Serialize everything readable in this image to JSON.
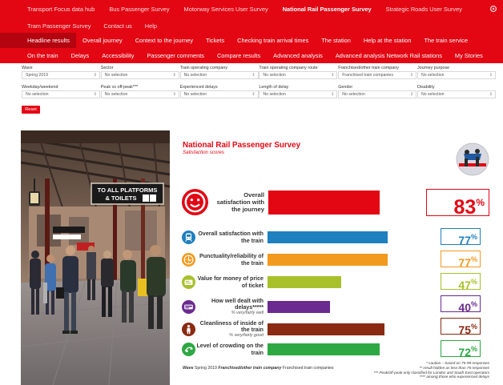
{
  "nav": {
    "top_items": [
      {
        "label": "Transport Focus data hub",
        "active": false
      },
      {
        "label": "Bus Passenger Survey",
        "active": false
      },
      {
        "label": "Motorway Services User Survey",
        "active": false
      },
      {
        "label": "National Rail Passenger Survey",
        "active": true
      },
      {
        "label": "Strategic Roads User Survey",
        "active": false
      }
    ],
    "second_items": [
      "Tram Passenger Survey",
      "Contact us",
      "Help"
    ],
    "tabs_row1": [
      {
        "label": "Headline results",
        "active": true
      },
      {
        "label": "Overall journey",
        "active": false
      },
      {
        "label": "Context to the journey",
        "active": false
      },
      {
        "label": "Tickets",
        "active": false
      },
      {
        "label": "Checking train arrival times",
        "active": false
      },
      {
        "label": "The station",
        "active": false
      },
      {
        "label": "Help at the station",
        "active": false
      },
      {
        "label": "The train service",
        "active": false
      }
    ],
    "tabs_row2": [
      "On the train",
      "Delays",
      "Accessibility",
      "Passenger comments",
      "Compare results",
      "Advanced analysis",
      "Advanced analysis Network Rail stations",
      "My Stories"
    ]
  },
  "filters": {
    "row1": [
      {
        "label": "Wave",
        "value": "Spring 2019"
      },
      {
        "label": "Sector",
        "value": "No selection"
      },
      {
        "label": "Train operating company",
        "value": "No selection"
      },
      {
        "label": "Train operating company route",
        "value": "No selection"
      },
      {
        "label": "Franchised/other train company",
        "value": "Franchised train companies"
      },
      {
        "label": "Journey purpose",
        "value": "No selection"
      }
    ],
    "row2": [
      {
        "label": "Weekday/weekend",
        "value": "No selection"
      },
      {
        "label": "Peak vs off-peak***",
        "value": "No selection"
      },
      {
        "label": "Experienced delays",
        "value": "No selection"
      },
      {
        "label": "Length of delay",
        "value": "No selection"
      },
      {
        "label": "Gender",
        "value": "No selection"
      },
      {
        "label": "Disability",
        "value": "No selection"
      }
    ],
    "reset_label": "Reset"
  },
  "photo": {
    "sign_line1": "TO ALL PLATFORMS",
    "sign_line2": "& TOILETS"
  },
  "report": {
    "title": "National Rail Passenger Survey",
    "subtitle": "Satisfaction scores",
    "headline": {
      "label": "Overall satisfaction with the journey",
      "value": 83,
      "value_text": "83",
      "unit": "%",
      "color": "#e30613",
      "icon": "smiley-icon"
    },
    "metrics": [
      {
        "label": "Overall satisfaction with the train",
        "note": "",
        "value": 77,
        "value_text": "77",
        "unit": "%",
        "color": "#1f80c0",
        "icon": "train-icon"
      },
      {
        "label": "Punctuality/reliability of the train",
        "note": "",
        "value": 77,
        "value_text": "77",
        "unit": "%",
        "color": "#f29a1e",
        "icon": "clock-icon"
      },
      {
        "label": "Value for money of price of ticket",
        "note": "",
        "value": 47,
        "value_text": "47",
        "unit": "%",
        "color": "#a8c12a",
        "icon": "ticket-icon"
      },
      {
        "label": "How well dealt with delays*****",
        "note": "% very/fairly well",
        "value": 40,
        "value_text": "40",
        "unit": "%",
        "color": "#6a2a90",
        "icon": "delay-icon"
      },
      {
        "label": "Cleanliness of inside of the train",
        "note": "% very/fairly good",
        "value": 75,
        "value_text": "75",
        "unit": "%",
        "color": "#8a2a12",
        "icon": "cleaner-icon"
      },
      {
        "label": "Level of crowding on the train",
        "note": "",
        "value": 72,
        "value_text": "72",
        "unit": "%",
        "color": "#2ea843",
        "icon": "crowding-icon"
      }
    ],
    "footer_left_wave_label": "Wave",
    "footer_left_wave_value": "Spring 2019",
    "footer_left_company_label": "Franchised/other train company",
    "footer_left_company_value": "Franchised train companies",
    "footnotes": [
      "* caution – based on 75-99 responses",
      "** result hidden as less than 75 responses",
      "*** Peak/off-peak only classified for London and South East operators",
      "**** among those who experienced delays"
    ]
  }
}
